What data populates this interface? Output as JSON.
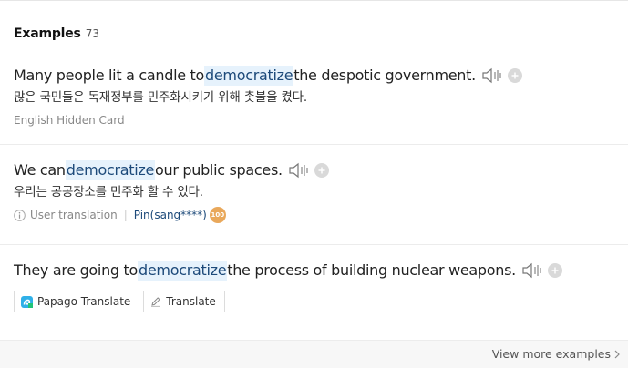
{
  "header": {
    "title": "Examples",
    "count": "73"
  },
  "examples": [
    {
      "before": "Many people lit a candle to ",
      "highlight": "democratize",
      "after": " the despotic government.",
      "translation": "많은 국민들은 독재정부를 민주화시키기 위해 촛불을 켰다.",
      "source": "English Hidden Card"
    },
    {
      "before": "We can ",
      "highlight": "democratize",
      "after": " our public spaces.",
      "translation": "우리는 공공장소를 민주화 할 수 있다.",
      "source_label": "User translation",
      "user": "Pin(sang****)",
      "badge": "100"
    },
    {
      "before": "They are going to ",
      "highlight": "democratize",
      "after": " the process of building nuclear weapons.",
      "buttons": {
        "papago": "Papago Translate",
        "translate": "Translate"
      }
    }
  ],
  "footer": {
    "more": "View more examples"
  },
  "icons": {
    "speaker": "speaker-icon",
    "add": "plus-circle-icon",
    "info": "info-icon",
    "papago": "papago-logo-icon",
    "pencil": "pencil-icon",
    "chevron": "chevron-right-icon"
  },
  "colors": {
    "highlight_bg": "#e6f2fc",
    "link": "#1d4a7a",
    "badge": "#e9a85b"
  }
}
